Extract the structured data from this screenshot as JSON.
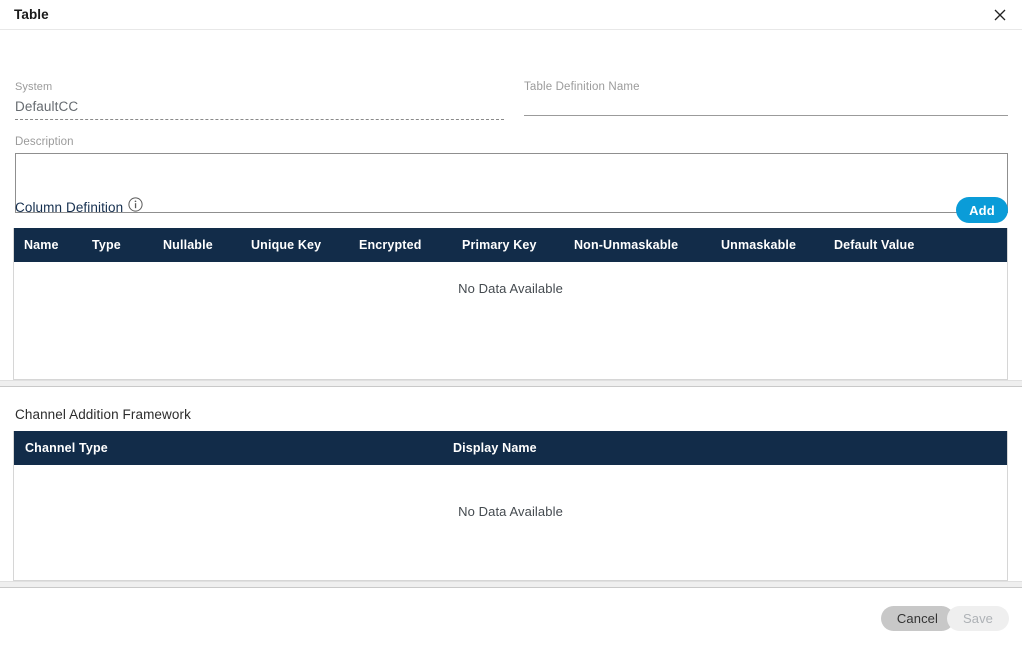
{
  "dialog": {
    "title": "Table",
    "close_icon": "close-icon"
  },
  "form": {
    "system": {
      "label": "System",
      "value": "DefaultCC"
    },
    "table_definition_name": {
      "label": "Table Definition Name",
      "value": "",
      "placeholder": ""
    },
    "description": {
      "label": "Description",
      "value": "",
      "placeholder": ""
    }
  },
  "column_definition": {
    "heading": "Column Definition",
    "info_icon": "info-icon",
    "add_label": "Add",
    "columns": [
      "Name",
      "Type",
      "Nullable",
      "Unique Key",
      "Encrypted",
      "Primary Key",
      "Non-Unmaskable",
      "Unmaskable",
      "Default Value"
    ],
    "rows": [],
    "empty_message": "No Data Available"
  },
  "channel_addition_framework": {
    "heading": "Channel Addition Framework",
    "columns": [
      "Channel Type",
      "Display Name"
    ],
    "rows": [],
    "empty_message": "No Data Available"
  },
  "footer": {
    "cancel_label": "Cancel",
    "save_label": "Save"
  },
  "colors": {
    "table_header_bg": "#122c49",
    "add_button": "#0a9cd8",
    "heading_navy": "#152f4f",
    "cancel_bg": "#c8c8c8",
    "save_bg": "#efefef"
  }
}
